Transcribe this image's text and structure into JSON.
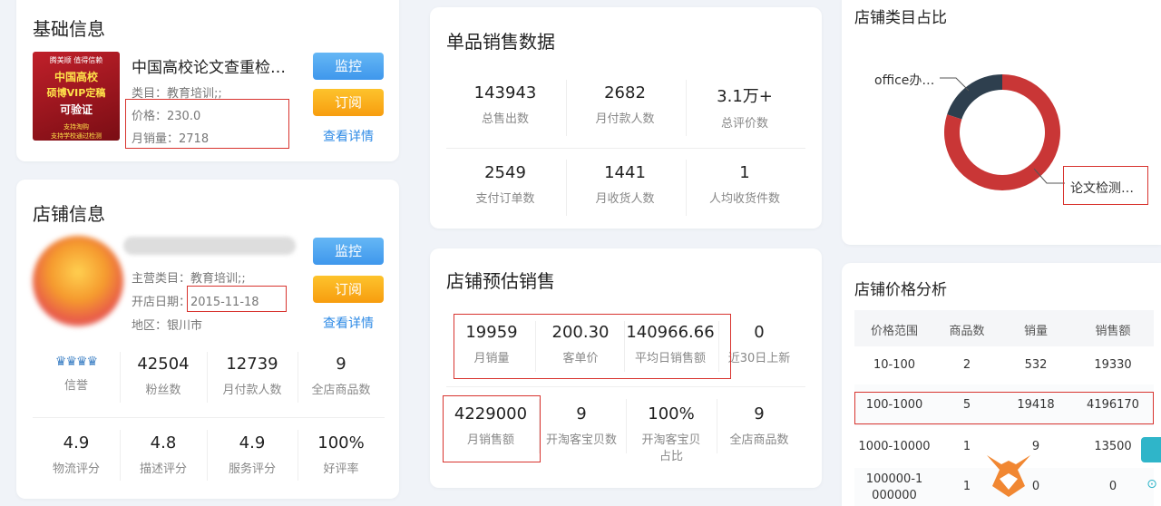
{
  "basic": {
    "title": "基础信息",
    "product_name": "中国高校论文查重检…",
    "cover_lines": [
      "腾美顺 值得信赖",
      "中国高校",
      "硕博VIP定稿",
      "可验证",
      "支持淘购",
      "支持学校通过检测"
    ],
    "category": "类目：教育培训;;",
    "price": "价格：230.0",
    "monthly_sales": "月销量：2718",
    "btn_monitor": "监控",
    "btn_subscribe": "订阅",
    "link_detail": "查看详情"
  },
  "shop": {
    "title": "店铺信息",
    "main_category": "主营类目：教育培训;;",
    "open_date": "开店日期：2015-11-18",
    "region": "地区：银川市",
    "btn_monitor": "监控",
    "btn_subscribe": "订阅",
    "link_detail": "查看详情",
    "stats_row1": [
      {
        "value": "",
        "label": "信誉"
      },
      {
        "value": "42504",
        "label": "粉丝数"
      },
      {
        "value": "12739",
        "label": "月付款人数"
      },
      {
        "value": "9",
        "label": "全店商品数"
      }
    ],
    "stats_row2": [
      {
        "value": "4.9",
        "label": "物流评分"
      },
      {
        "value": "4.8",
        "label": "描述评分"
      },
      {
        "value": "4.9",
        "label": "服务评分"
      },
      {
        "value": "100%",
        "label": "好评率"
      }
    ]
  },
  "single": {
    "title": "单品销售数据",
    "stats_row1": [
      {
        "value": "143943",
        "label": "总售出数"
      },
      {
        "value": "2682",
        "label": "月付款人数"
      },
      {
        "value": "3.1万+",
        "label": "总评价数"
      }
    ],
    "stats_row2": [
      {
        "value": "2549",
        "label": "支付订单数"
      },
      {
        "value": "1441",
        "label": "月收货人数"
      },
      {
        "value": "1",
        "label": "人均收货件数"
      }
    ]
  },
  "estimate": {
    "title": "店铺预估销售",
    "stats_row1": [
      {
        "value": "19959",
        "label": "月销量"
      },
      {
        "value": "200.30",
        "label": "客单价"
      },
      {
        "value": "140966.66",
        "label": "平均日销售额"
      },
      {
        "value": "0",
        "label": "近30日上新"
      }
    ],
    "stats_row2": [
      {
        "value": "4229000",
        "label": "月销售额"
      },
      {
        "value": "9",
        "label": "开淘客宝贝数"
      },
      {
        "value": "100%",
        "label": "开淘客宝贝占比"
      },
      {
        "value": "9",
        "label": "全店商品数"
      }
    ]
  },
  "category_share": {
    "title": "店铺类目占比",
    "chart_data": {
      "type": "pie",
      "categories": [
        "office办…",
        "论文检测…"
      ],
      "values": [
        20,
        80
      ],
      "colors": [
        "#2e3f4e",
        "#c93636"
      ],
      "legend": "none"
    }
  },
  "price_analysis": {
    "title": "店铺价格分析",
    "headers": [
      "价格范围",
      "商品数",
      "销量",
      "销售额"
    ],
    "rows": [
      [
        "10-100",
        "2",
        "532",
        "19330"
      ],
      [
        "100-1000",
        "5",
        "19418",
        "4196170"
      ],
      [
        "1000-10000",
        "1",
        "9",
        "13500"
      ],
      [
        "100000-1000000",
        "1",
        "0",
        "0"
      ]
    ]
  },
  "colors": {
    "accent_blue": "#3f97ec",
    "accent_orange": "#f79d0f",
    "highlight_red": "#d8342f"
  }
}
